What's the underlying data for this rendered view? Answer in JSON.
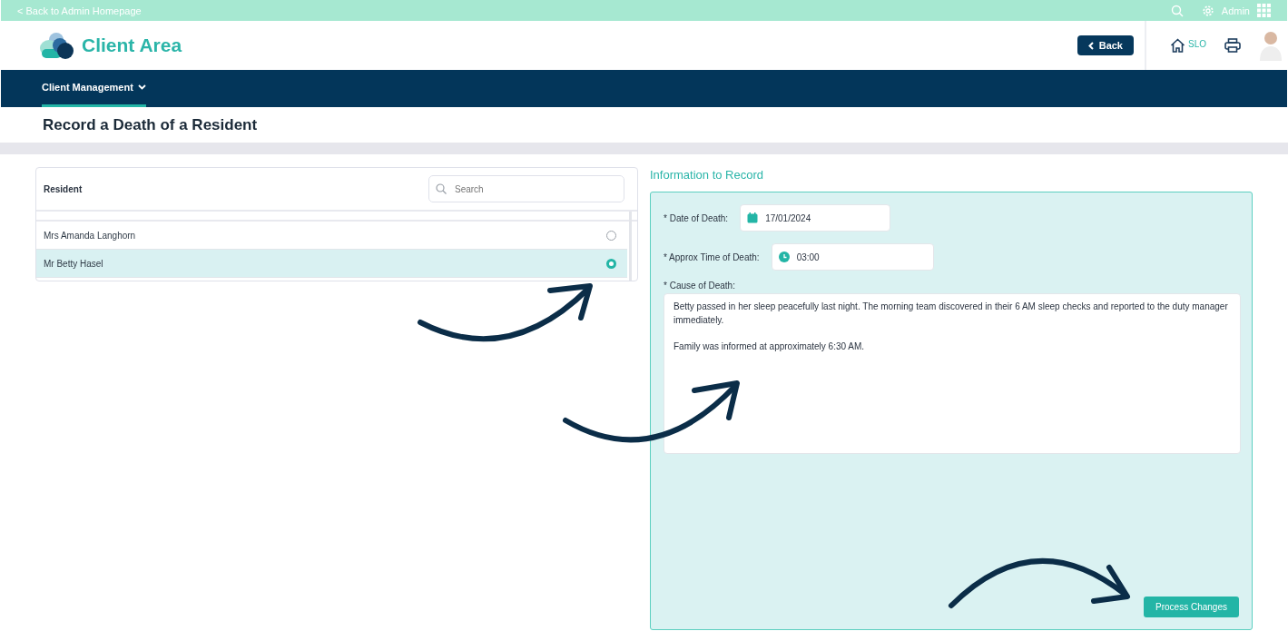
{
  "top_bar": {
    "back_link": "< Back to Admin Homepage",
    "user": "Admin"
  },
  "header": {
    "title": "Client Area",
    "back_button": "Back",
    "home_label": "SLO"
  },
  "nav": {
    "items": [
      {
        "label": "Client Management",
        "selected": true
      }
    ]
  },
  "page_title": "Record a Death of a Resident",
  "resident_list": {
    "heading": "Resident",
    "search": {
      "placeholder": "Search"
    },
    "rows": [
      {
        "name": "Mrs Amanda Langhorn",
        "selected": false
      },
      {
        "name": "Mr Betty Hasel",
        "selected": true
      }
    ]
  },
  "form": {
    "title": "Information to Record",
    "date_label": "* Date of Death:",
    "date_value": "17/01/2024",
    "time_label": "* Approx Time of Death:",
    "time_value": "03:00",
    "cause_label": "* Cause of Death:",
    "cause_value": "Betty passed in her sleep peacefully last night. The morning team discovered in their 6 AM sleep checks and reported to the duty manager immediately.\n\nFamily was informed at approximately 6:30 AM.",
    "submit_button": "Process Changes"
  }
}
